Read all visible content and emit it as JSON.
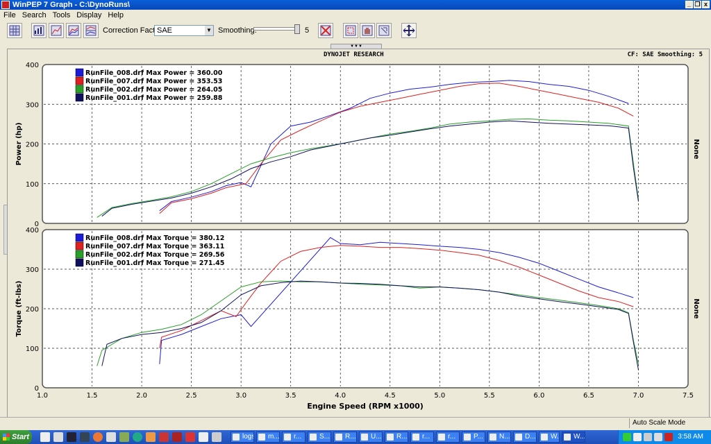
{
  "window": {
    "title": "WinPEP 7    Graph - C:\\DynoRuns\\",
    "buttons": {
      "minimize": "_",
      "restore": "❐",
      "close": "x"
    }
  },
  "menu": [
    "File",
    "Search",
    "Tools",
    "Display",
    "Help"
  ],
  "toolbar": {
    "icons": [
      "grid-icon",
      "bar-graph-icon",
      "line-graph-icon",
      "multi-graph-icon",
      "stacked-graph-icon",
      "clear-icon",
      "zoom-select-icon",
      "hand-pan-icon",
      "zoom-out-icon",
      "move-axes-icon"
    ],
    "correction_factor_label": "Correction Factor:",
    "correction_factor_value": "SAE",
    "smoothing_label": "Smoothing:",
    "smoothing_value": "5",
    "smoothing_level": 1.0
  },
  "graph": {
    "header_title": "DYNOJET RESEARCH",
    "header_info": "CF: SAE  Smoothing: 5",
    "right_label": "None"
  },
  "chart_data": [
    {
      "type": "line",
      "ylabel": "Power (hp)",
      "xlim": [
        1.0,
        7.5
      ],
      "ylim": [
        0,
        400
      ],
      "yticks": [
        0,
        100,
        200,
        300,
        400
      ],
      "grid": true,
      "legend_position": "top-left",
      "series": [
        {
          "name": "RunFile_008.drf Max Power = 360.00",
          "color": "#1c1cd8",
          "x": [
            2.18,
            2.3,
            2.5,
            2.7,
            2.85,
            3.0,
            3.1,
            3.3,
            3.5,
            3.7,
            3.9,
            4.1,
            4.3,
            4.5,
            4.7,
            4.9,
            5.1,
            5.3,
            5.5,
            5.7,
            5.9,
            6.1,
            6.3,
            6.5,
            6.7,
            6.9
          ],
          "y": [
            32,
            55,
            66,
            80,
            95,
            103,
            92,
            200,
            245,
            255,
            272,
            290,
            315,
            328,
            338,
            343,
            350,
            355,
            357,
            360,
            357,
            350,
            345,
            335,
            320,
            302
          ]
        },
        {
          "name": "RunFile_007.drf Max Power = 353.53",
          "color": "#e02020",
          "x": [
            2.18,
            2.3,
            2.5,
            2.7,
            2.85,
            2.95,
            3.05,
            3.2,
            3.4,
            3.6,
            3.8,
            4.0,
            4.2,
            4.4,
            4.6,
            4.8,
            5.0,
            5.2,
            5.4,
            5.6,
            5.8,
            6.0,
            6.2,
            6.4,
            6.6,
            6.8,
            6.95
          ],
          "y": [
            25,
            52,
            62,
            76,
            90,
            95,
            100,
            150,
            210,
            235,
            258,
            280,
            295,
            305,
            315,
            325,
            335,
            345,
            352,
            353,
            345,
            335,
            325,
            315,
            305,
            290,
            270
          ]
        },
        {
          "name": "RunFile_002.drf Max Power = 264.05",
          "color": "#28a028",
          "x": [
            1.55,
            1.7,
            1.9,
            2.1,
            2.3,
            2.5,
            2.7,
            2.9,
            3.1,
            3.3,
            3.5,
            3.7,
            3.9,
            4.1,
            4.3,
            4.5,
            4.7,
            4.9,
            5.1,
            5.3,
            5.5,
            5.7,
            5.9,
            6.1,
            6.3,
            6.5,
            6.7,
            6.9,
            6.95,
            7.0
          ],
          "y": [
            15,
            40,
            50,
            58,
            67,
            80,
            100,
            125,
            150,
            165,
            178,
            188,
            196,
            205,
            215,
            225,
            232,
            240,
            250,
            255,
            258,
            262,
            263,
            260,
            258,
            255,
            252,
            245,
            150,
            60
          ]
        },
        {
          "name": "RunFile_001.drf Max Power = 259.88",
          "color": "#101060",
          "x": [
            1.6,
            1.7,
            1.9,
            2.1,
            2.3,
            2.5,
            2.7,
            2.9,
            3.1,
            3.3,
            3.5,
            3.7,
            3.9,
            4.1,
            4.3,
            4.5,
            4.7,
            4.9,
            5.1,
            5.3,
            5.5,
            5.7,
            5.9,
            6.1,
            6.3,
            6.5,
            6.7,
            6.9,
            6.95,
            7.0
          ],
          "y": [
            18,
            38,
            48,
            56,
            64,
            76,
            92,
            112,
            138,
            155,
            168,
            185,
            195,
            205,
            215,
            222,
            230,
            238,
            245,
            250,
            255,
            258,
            255,
            252,
            250,
            248,
            246,
            240,
            140,
            55
          ]
        }
      ]
    },
    {
      "type": "line",
      "xlabel": "Engine Speed (RPM x1000)",
      "ylabel": "Torque (ft-lbs)",
      "xlim": [
        1.0,
        7.5
      ],
      "ylim": [
        0,
        400
      ],
      "xticks": [
        1.0,
        1.5,
        2.0,
        2.5,
        3.0,
        3.5,
        4.0,
        4.5,
        5.0,
        5.5,
        6.0,
        6.5,
        7.0,
        7.5
      ],
      "yticks": [
        0,
        100,
        200,
        300,
        400
      ],
      "grid": true,
      "legend_position": "top-left",
      "series": [
        {
          "name": "RunFile_008.drf Max Torque = 380.12",
          "color": "#1c1cd8",
          "x": [
            2.18,
            2.2,
            2.4,
            2.6,
            2.8,
            3.0,
            3.1,
            3.9,
            4.0,
            4.2,
            4.4,
            4.6,
            4.8,
            5.0,
            5.2,
            5.4,
            5.6,
            5.8,
            6.0,
            6.2,
            6.4,
            6.6,
            6.8,
            6.95
          ],
          "y": [
            60,
            120,
            135,
            155,
            175,
            185,
            155,
            380,
            365,
            362,
            368,
            365,
            362,
            358,
            355,
            350,
            342,
            330,
            315,
            295,
            275,
            255,
            240,
            228
          ]
        },
        {
          "name": "RunFile_007.drf Max Torque = 363.11",
          "color": "#e02020",
          "x": [
            2.18,
            2.2,
            2.4,
            2.6,
            2.8,
            2.95,
            3.05,
            3.2,
            3.4,
            3.6,
            3.8,
            4.0,
            4.2,
            4.4,
            4.6,
            4.8,
            5.0,
            5.2,
            5.4,
            5.6,
            5.8,
            6.0,
            6.2,
            6.4,
            6.6,
            6.8,
            6.95
          ],
          "y": [
            100,
            128,
            145,
            170,
            195,
            180,
            215,
            265,
            320,
            345,
            355,
            360,
            358,
            355,
            355,
            352,
            348,
            342,
            335,
            322,
            305,
            285,
            265,
            245,
            228,
            218,
            205
          ]
        },
        {
          "name": "RunFile_002.drf Max Torque = 269.56",
          "color": "#28a028",
          "x": [
            1.55,
            1.6,
            1.8,
            2.0,
            2.2,
            2.4,
            2.6,
            2.8,
            3.0,
            3.2,
            3.4,
            3.6,
            3.8,
            4.0,
            4.2,
            4.4,
            4.6,
            4.8,
            5.0,
            5.2,
            5.4,
            5.6,
            5.8,
            6.0,
            6.2,
            6.4,
            6.6,
            6.8,
            6.9,
            6.95,
            7.0
          ],
          "y": [
            55,
            95,
            125,
            140,
            148,
            160,
            185,
            220,
            255,
            268,
            270,
            268,
            268,
            265,
            262,
            260,
            258,
            252,
            255,
            252,
            248,
            242,
            235,
            228,
            222,
            215,
            208,
            200,
            190,
            120,
            60
          ]
        },
        {
          "name": "RunFile_001.drf Max Torque = 271.45",
          "color": "#101060",
          "x": [
            1.6,
            1.65,
            1.8,
            2.0,
            2.2,
            2.4,
            2.6,
            2.8,
            3.0,
            3.2,
            3.4,
            3.6,
            3.8,
            4.0,
            4.2,
            4.4,
            4.6,
            4.8,
            5.0,
            5.2,
            5.4,
            5.6,
            5.8,
            6.0,
            6.2,
            6.4,
            6.6,
            6.8,
            6.9,
            6.95,
            7.0
          ],
          "y": [
            55,
            110,
            125,
            135,
            140,
            150,
            165,
            195,
            235,
            258,
            266,
            270,
            268,
            265,
            264,
            262,
            258,
            255,
            255,
            252,
            248,
            242,
            232,
            225,
            218,
            212,
            205,
            198,
            188,
            115,
            45
          ]
        }
      ]
    }
  ],
  "statusbar": {
    "mode": "Auto Scale Mode"
  },
  "taskbar": {
    "start_label": "Start",
    "tasks": [
      "logs",
      "m...",
      "r...",
      "S...",
      "R...",
      "U...",
      "R...",
      "r...",
      "r...",
      "P...",
      "N...",
      "D...",
      "W...",
      "W..."
    ],
    "clock": "3:58 AM"
  }
}
